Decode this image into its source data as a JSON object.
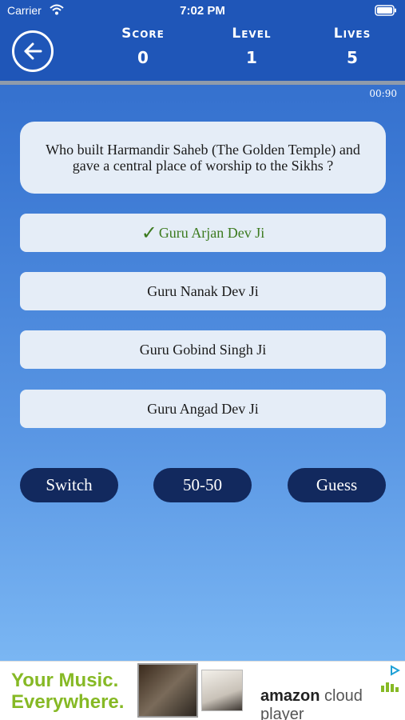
{
  "status_bar": {
    "carrier": "Carrier",
    "time": "7:02 PM"
  },
  "header": {
    "score": {
      "label": "Score",
      "value": "0"
    },
    "level": {
      "label": "Level",
      "value": "1"
    },
    "lives": {
      "label": "Lives",
      "value": "5"
    }
  },
  "timer": {
    "text": "00:90",
    "progress_fraction": 1.0
  },
  "question": "Who built Harmandir Saheb (The Golden Temple) and gave a central place of worship to the Sikhs ?",
  "answers": [
    {
      "text": "Guru Arjan Dev Ji",
      "correct": true
    },
    {
      "text": "Guru Nanak Dev Ji"
    },
    {
      "text": "Guru Gobind Singh Ji"
    },
    {
      "text": "Guru Angad Dev Ji"
    }
  ],
  "lifelines": {
    "switch": "Switch",
    "fifty": "50-50",
    "guess": "Guess"
  },
  "ad": {
    "headline_1": "Your Music.",
    "headline_2": "Everywhere.",
    "brand_1": "amazon",
    "brand_2": "cloud player"
  },
  "colors": {
    "header": "#1f56b8",
    "card": "#e5edf7",
    "correct": "#3b7a1e",
    "lifeline": "#12295e",
    "ad_green": "#86b925"
  },
  "icons": [
    "wifi-icon",
    "battery-icon",
    "back-arrow-icon",
    "check-icon",
    "ad-choices-icon"
  ]
}
